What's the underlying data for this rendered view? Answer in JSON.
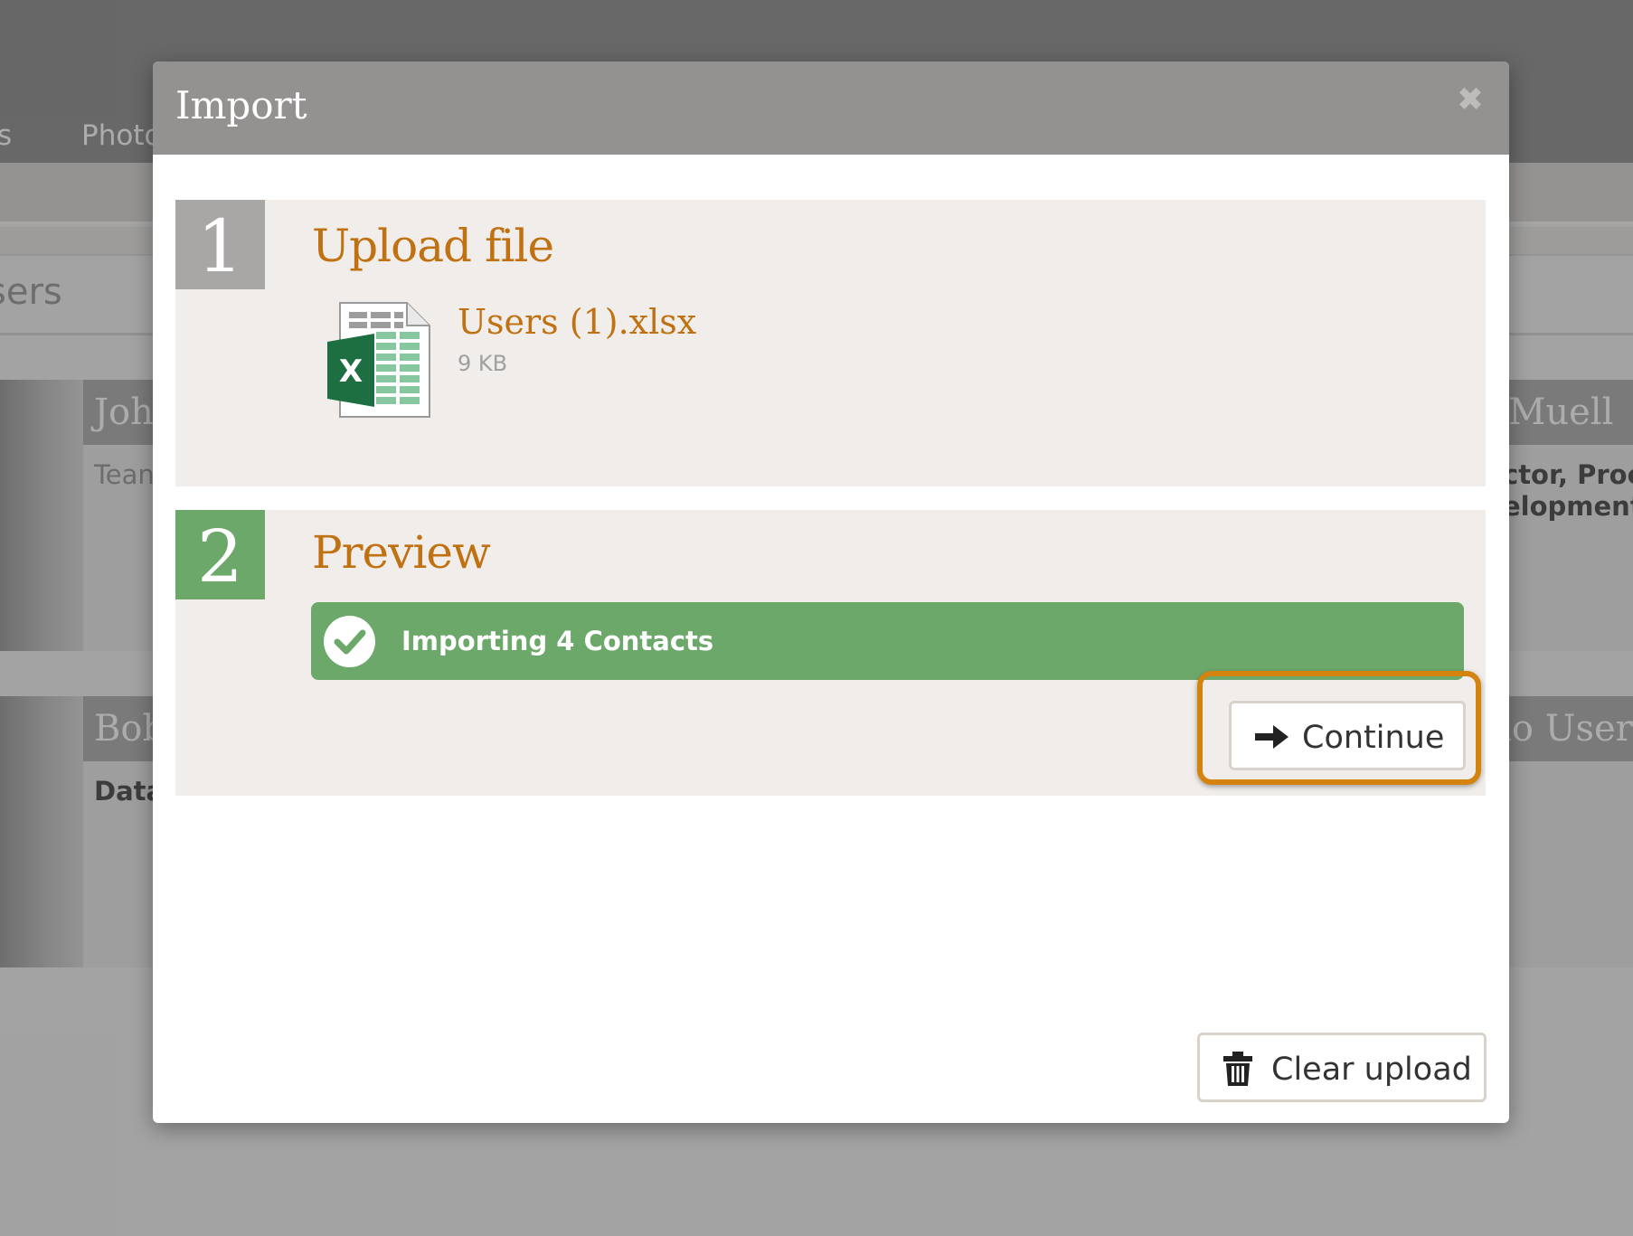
{
  "background": {
    "nav": [
      "s",
      "Photo"
    ],
    "search_text": "sers",
    "cards": [
      {
        "name": "Joh",
        "role": "Tean"
      },
      {
        "name": "e Muell",
        "role_lines": [
          "ctor, Proc",
          "elopment"
        ]
      },
      {
        "name": "Bob",
        "role": "Data"
      },
      {
        "name": "mo User"
      }
    ]
  },
  "modal": {
    "title": "Import",
    "close_icon": "close-icon",
    "steps": [
      {
        "number": "1",
        "title": "Upload file",
        "color": "#a9a7a5"
      },
      {
        "number": "2",
        "title": "Preview",
        "color": "#6da86b"
      }
    ],
    "file": {
      "name": "Users (1).xlsx",
      "size": "9 KB",
      "icon": "excel-file-icon"
    },
    "status": {
      "text": "Importing 4 Contacts",
      "icon": "check-circle-icon",
      "color": "#6da86b"
    },
    "continue_button": {
      "label": "Continue",
      "icon": "arrow-right-icon"
    },
    "clear_button": {
      "label": "Clear upload",
      "icon": "trash-icon"
    },
    "accent_color": "#c07212",
    "highlight_color": "#d4830e"
  }
}
